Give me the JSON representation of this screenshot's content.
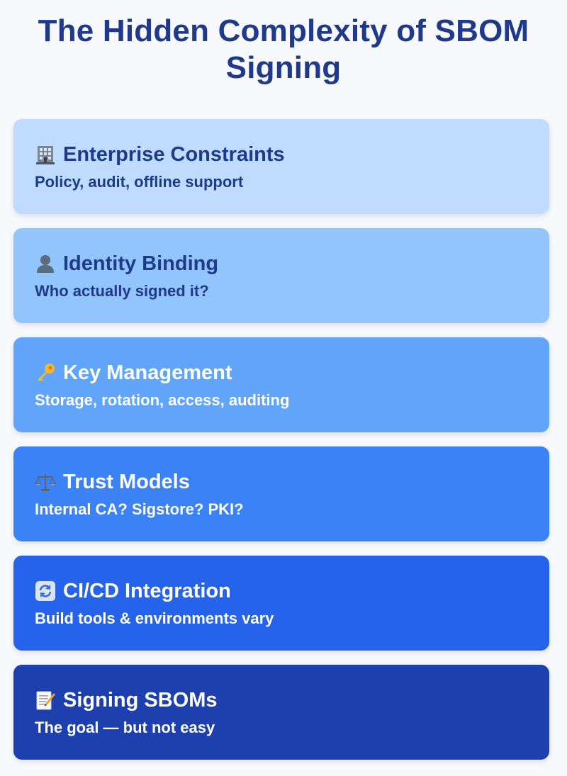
{
  "title": "The Hidden Complexity of SBOM Signing",
  "layers": [
    {
      "icon": "office-building-icon",
      "title": "Enterprise Constraints",
      "subtitle": "Policy, audit, offline support",
      "background": "#bfdbfe",
      "text_color": "#1e3a8a"
    },
    {
      "icon": "user-silhouette-icon",
      "title": "Identity Binding",
      "subtitle": "Who actually signed it?",
      "background": "#93c5fd",
      "text_color": "#1e3a8a"
    },
    {
      "icon": "key-icon",
      "title": "Key Management",
      "subtitle": "Storage, rotation, access, auditing",
      "background": "#60a5fa",
      "text_color": "#ffffff"
    },
    {
      "icon": "balance-scale-icon",
      "title": "Trust Models",
      "subtitle": "Internal CA? Sigstore? PKI?",
      "background": "#3b82f6",
      "text_color": "#ffffff"
    },
    {
      "icon": "refresh-arrows-icon",
      "title": "CI/CD Integration",
      "subtitle": "Build tools & environments vary",
      "background": "#2563eb",
      "text_color": "#ffffff"
    },
    {
      "icon": "memo-pencil-icon",
      "title": "Signing SBOMs",
      "subtitle": "The goal — but not easy",
      "background": "#1e40af",
      "text_color": "#ffffff"
    }
  ]
}
